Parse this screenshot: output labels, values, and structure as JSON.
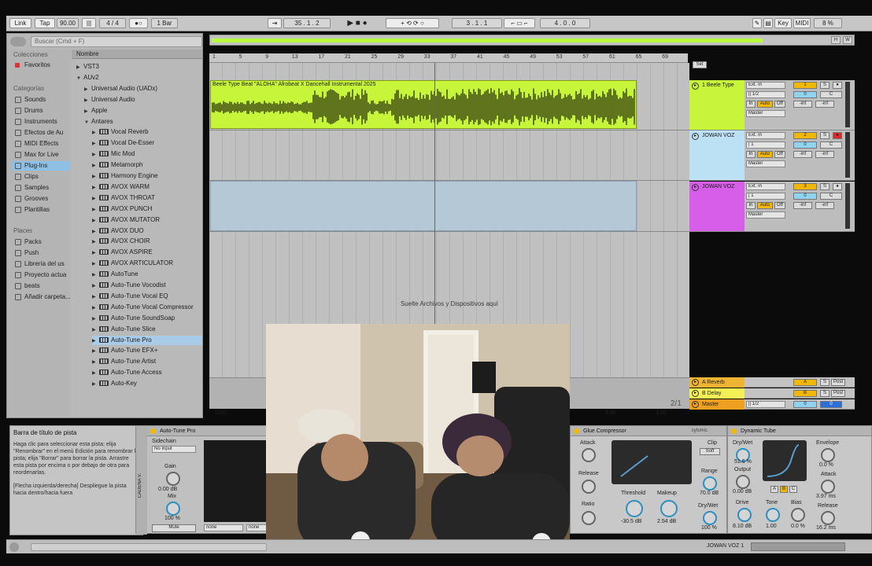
{
  "transport": {
    "link": "Link",
    "tap": "Tap",
    "tempo": "90.00",
    "time_sig": "4 / 4",
    "quantize": "1 Bar",
    "position": "35 . 1 . 2",
    "loop_start": "3 . 1 . 1",
    "loop_length": "4 . 0 . 0",
    "key": "Key",
    "midi": "MIDI",
    "cpu": "8 %"
  },
  "browser": {
    "search_placeholder": "Buscar (Cmd + F)",
    "collections_header": "Colecciones",
    "favorites": "Favoritos",
    "categories_header": "Categorías",
    "categories": [
      "Sounds",
      "Drums",
      "Instruments",
      "Efectos de Au",
      "MIDI Effects",
      "Max for Live",
      "Plug-Ins",
      "Clips",
      "Samples",
      "Grooves",
      "Plantillas"
    ],
    "places_header": "Places",
    "places": [
      "Packs",
      "Push",
      "Librería del us",
      "Proyecto actua",
      "beats",
      "Añadir carpeta..."
    ],
    "list_header": "Nombre",
    "items": [
      {
        "label": "VST3",
        "indent": 0,
        "arrow": "▶"
      },
      {
        "label": "AUv2",
        "indent": 0,
        "arrow": "▼"
      },
      {
        "label": "Universal Audio (UADx)",
        "indent": 1,
        "arrow": "▶"
      },
      {
        "label": "Universal Audio",
        "indent": 1,
        "arrow": "▶"
      },
      {
        "label": "Apple",
        "indent": 1,
        "arrow": "▶"
      },
      {
        "label": "Antares",
        "indent": 1,
        "arrow": "▼"
      },
      {
        "label": "Vocal Reverb",
        "indent": 2,
        "arrow": "▶"
      },
      {
        "label": "Vocal De-Esser",
        "indent": 2,
        "arrow": "▶"
      },
      {
        "label": "Mic Mod",
        "indent": 2,
        "arrow": "▶"
      },
      {
        "label": "Metamorph",
        "indent": 2,
        "arrow": "▶"
      },
      {
        "label": "Harmony Engine",
        "indent": 2,
        "arrow": "▶"
      },
      {
        "label": "AVOX WARM",
        "indent": 2,
        "arrow": "▶"
      },
      {
        "label": "AVOX THROAT",
        "indent": 2,
        "arrow": "▶"
      },
      {
        "label": "AVOX PUNCH",
        "indent": 2,
        "arrow": "▶"
      },
      {
        "label": "AVOX MUTATOR",
        "indent": 2,
        "arrow": "▶"
      },
      {
        "label": "AVOX DUO",
        "indent": 2,
        "arrow": "▶"
      },
      {
        "label": "AVOX CHOIR",
        "indent": 2,
        "arrow": "▶"
      },
      {
        "label": "AVOX ASPIRE",
        "indent": 2,
        "arrow": "▶"
      },
      {
        "label": "AVOX ARTICULATOR",
        "indent": 2,
        "arrow": "▶"
      },
      {
        "label": "AutoTune",
        "indent": 2,
        "arrow": "▶"
      },
      {
        "label": "Auto-Tune Vocodist",
        "indent": 2,
        "arrow": "▶"
      },
      {
        "label": "Auto-Tune Vocal EQ",
        "indent": 2,
        "arrow": "▶"
      },
      {
        "label": "Auto-Tune Vocal Compressor",
        "indent": 2,
        "arrow": "▶"
      },
      {
        "label": "Auto-Tune SoundSoap",
        "indent": 2,
        "arrow": "▶"
      },
      {
        "label": "Auto-Tune Slice",
        "indent": 2,
        "arrow": "▶"
      },
      {
        "label": "Auto-Tune Pro",
        "indent": 2,
        "arrow": "▶"
      },
      {
        "label": "Auto-Tune EFX+",
        "indent": 2,
        "arrow": "▶"
      },
      {
        "label": "Auto-Tune Artist",
        "indent": 2,
        "arrow": "▶"
      },
      {
        "label": "Auto-Tune Access",
        "indent": 2,
        "arrow": "▶"
      },
      {
        "label": "Auto-Key",
        "indent": 2,
        "arrow": "▶"
      }
    ]
  },
  "ruler_bars": [
    "1",
    "5",
    "9",
    "13",
    "17",
    "21",
    "25",
    "29",
    "33",
    "37",
    "41",
    "45",
    "49",
    "53",
    "57",
    "61",
    "65",
    "69"
  ],
  "arrangement": {
    "clip_name": "Beele Type Beat \"ALOHA\"  Afrobeat X Dancehall Instrumental 2025",
    "drop_message": "Suelte Archivos y Dispositivos aquí",
    "set_label": "Set",
    "time_start": "0:00",
    "time_240": "2:40",
    "time_300": "3:00",
    "page": "2/1"
  },
  "tracks": [
    {
      "name": "1 Beele Type",
      "number": "1",
      "color": "#c8f43c",
      "input": "Ext. In",
      "channel": "|| 1/2",
      "output": "Master",
      "vol": "0",
      "pan": "C",
      "armed": false
    },
    {
      "name": "JOWAN VOZ",
      "number": "2",
      "color": "#bde1f4",
      "input": "Ext. In",
      "channel": "| 1",
      "output": "Master",
      "vol": "0",
      "pan": "C",
      "armed": true
    },
    {
      "name": "JOWAN VOZ",
      "number": "3",
      "color": "#d65ee8",
      "input": "Ext. In",
      "channel": "| 1",
      "output": "Master",
      "vol": "0",
      "pan": "C",
      "armed": false
    }
  ],
  "track_buttons": {
    "in": "In",
    "auto": "Auto",
    "off": "Off",
    "inf": "-inf",
    "solo": "S"
  },
  "returns": [
    {
      "name": "A Reverb",
      "letter": "A",
      "color": "#f0b434"
    },
    {
      "name": "B Delay",
      "letter": "B",
      "color": "#f4f056"
    },
    {
      "name": "Master",
      "letter": "",
      "color": "#f0a020"
    }
  ],
  "return_buttons": {
    "post": "Post",
    "master_channel": "|| 1/2",
    "master_vol": "0"
  },
  "info": {
    "title": "Barra de título de pista",
    "body": "Haga clic para seleccionar esta pista; elija \"Renombrar\" en el menú Edición para renombrar la pista; elija \"Borrar\" para borrar la pista. Arrastre esta pista por encima o por debajo de otra para reordenarlas.",
    "hint": "[Flecha izquierda/derecha] Despliegue la pista hacia dentro/hacia fuera"
  },
  "chain": {
    "title": "Auto-Tune Pro",
    "rack_label": "CADENA V.",
    "sidechain": "Sidechain",
    "input": "No Input",
    "gain_label": "Gain",
    "gain_value": "0.00 dB",
    "mix_label": "Mix",
    "mix_value": "100 %",
    "mute": "Mute",
    "none": "none"
  },
  "glue": {
    "title": "Glue Compressor",
    "brand": "cytomic",
    "attack_label": "Attack",
    "release_label": "Release",
    "ratio_label": "Ratio",
    "clip_label": "Clip",
    "soft": "Soft",
    "threshold_label": "Threshold",
    "threshold_value": "-30.5 dB",
    "makeup_label": "Makeup",
    "makeup_value": "2.54 dB",
    "range_label": "Range",
    "range_value": "70.0 dB",
    "drywet_label": "Dry/Wet",
    "drywet_value": "100 %"
  },
  "dtube": {
    "title": "Dynamic Tube",
    "drywet_label": "Dry/Wet",
    "drywet_value": "51.6 %",
    "output_label": "Output",
    "output_value": "0.00 dB",
    "drive_label": "Drive",
    "drive_value": "8.10 dB",
    "tone_label": "Tone",
    "tone_value": "1.00",
    "bias_label": "Bias",
    "bias_value": "0.0 %",
    "envelope_label": "Envelope",
    "envelope_value": "0.0 %",
    "attack_label": "Attack",
    "attack_value": "3.97 ms",
    "release_label": "Release",
    "release_value": "16.2 ms",
    "abc": [
      "A",
      "B",
      "C"
    ]
  },
  "status": {
    "track": "JOWAN VOZ 1"
  },
  "colors": {
    "clip_green": "#c6f53a",
    "selection_blue": "#8ec0e6",
    "device_yellow": "#f2b800",
    "knob_blue": "#2d8fc0"
  }
}
